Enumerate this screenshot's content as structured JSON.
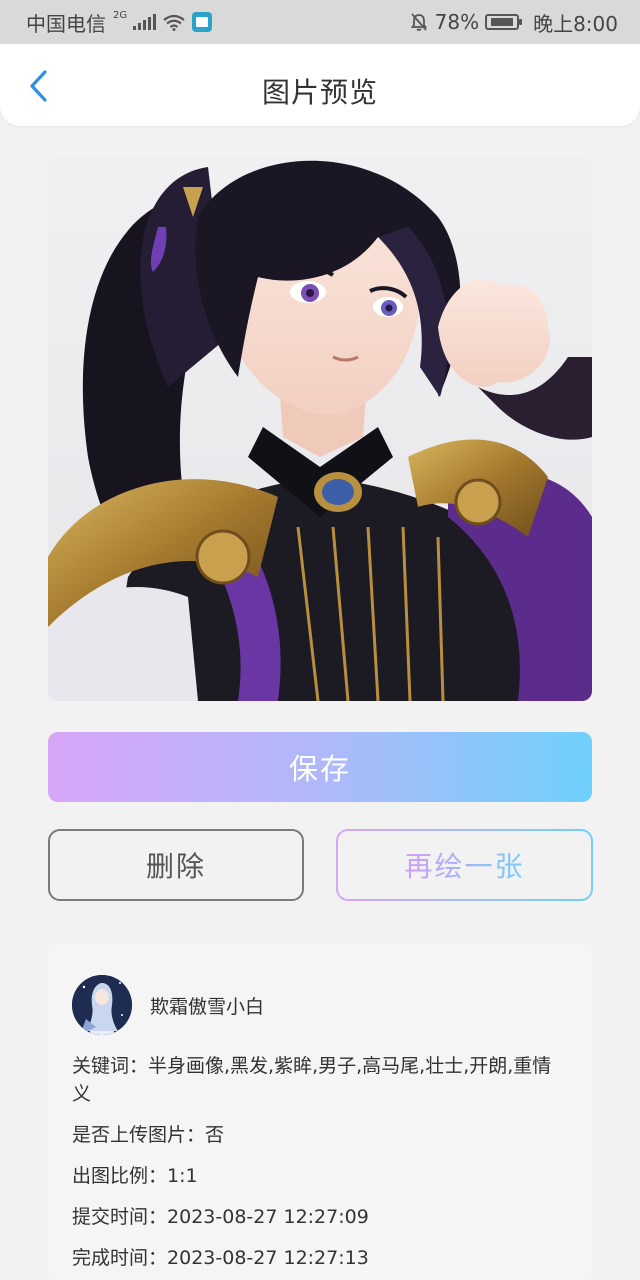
{
  "status_bar": {
    "carrier": "中国电信",
    "network": "2G",
    "battery": "78%",
    "time": "晚上8:00"
  },
  "header": {
    "title": "图片预览"
  },
  "actions": {
    "save_label": "保存",
    "delete_label": "删除",
    "redraw_label": "再绘一张"
  },
  "info": {
    "username": "欺霜傲雪小白",
    "keywords_label": "关键词：",
    "keywords_value": "半身画像,黑发,紫眸,男子,高马尾,壮士,开朗,重情义",
    "upload_label": "是否上传图片：",
    "upload_value": "否",
    "ratio_label": "出图比例：",
    "ratio_value": "1:1",
    "submit_label": "提交时间：",
    "submit_value": "2023-08-27 12:27:09",
    "finish_label": "完成时间：",
    "finish_value": "2023-08-27 12:27:13"
  },
  "colors": {
    "accent_blue": "#2f8fe0",
    "gradient_start": "#d8a6f8",
    "gradient_end": "#6fd0fb"
  }
}
